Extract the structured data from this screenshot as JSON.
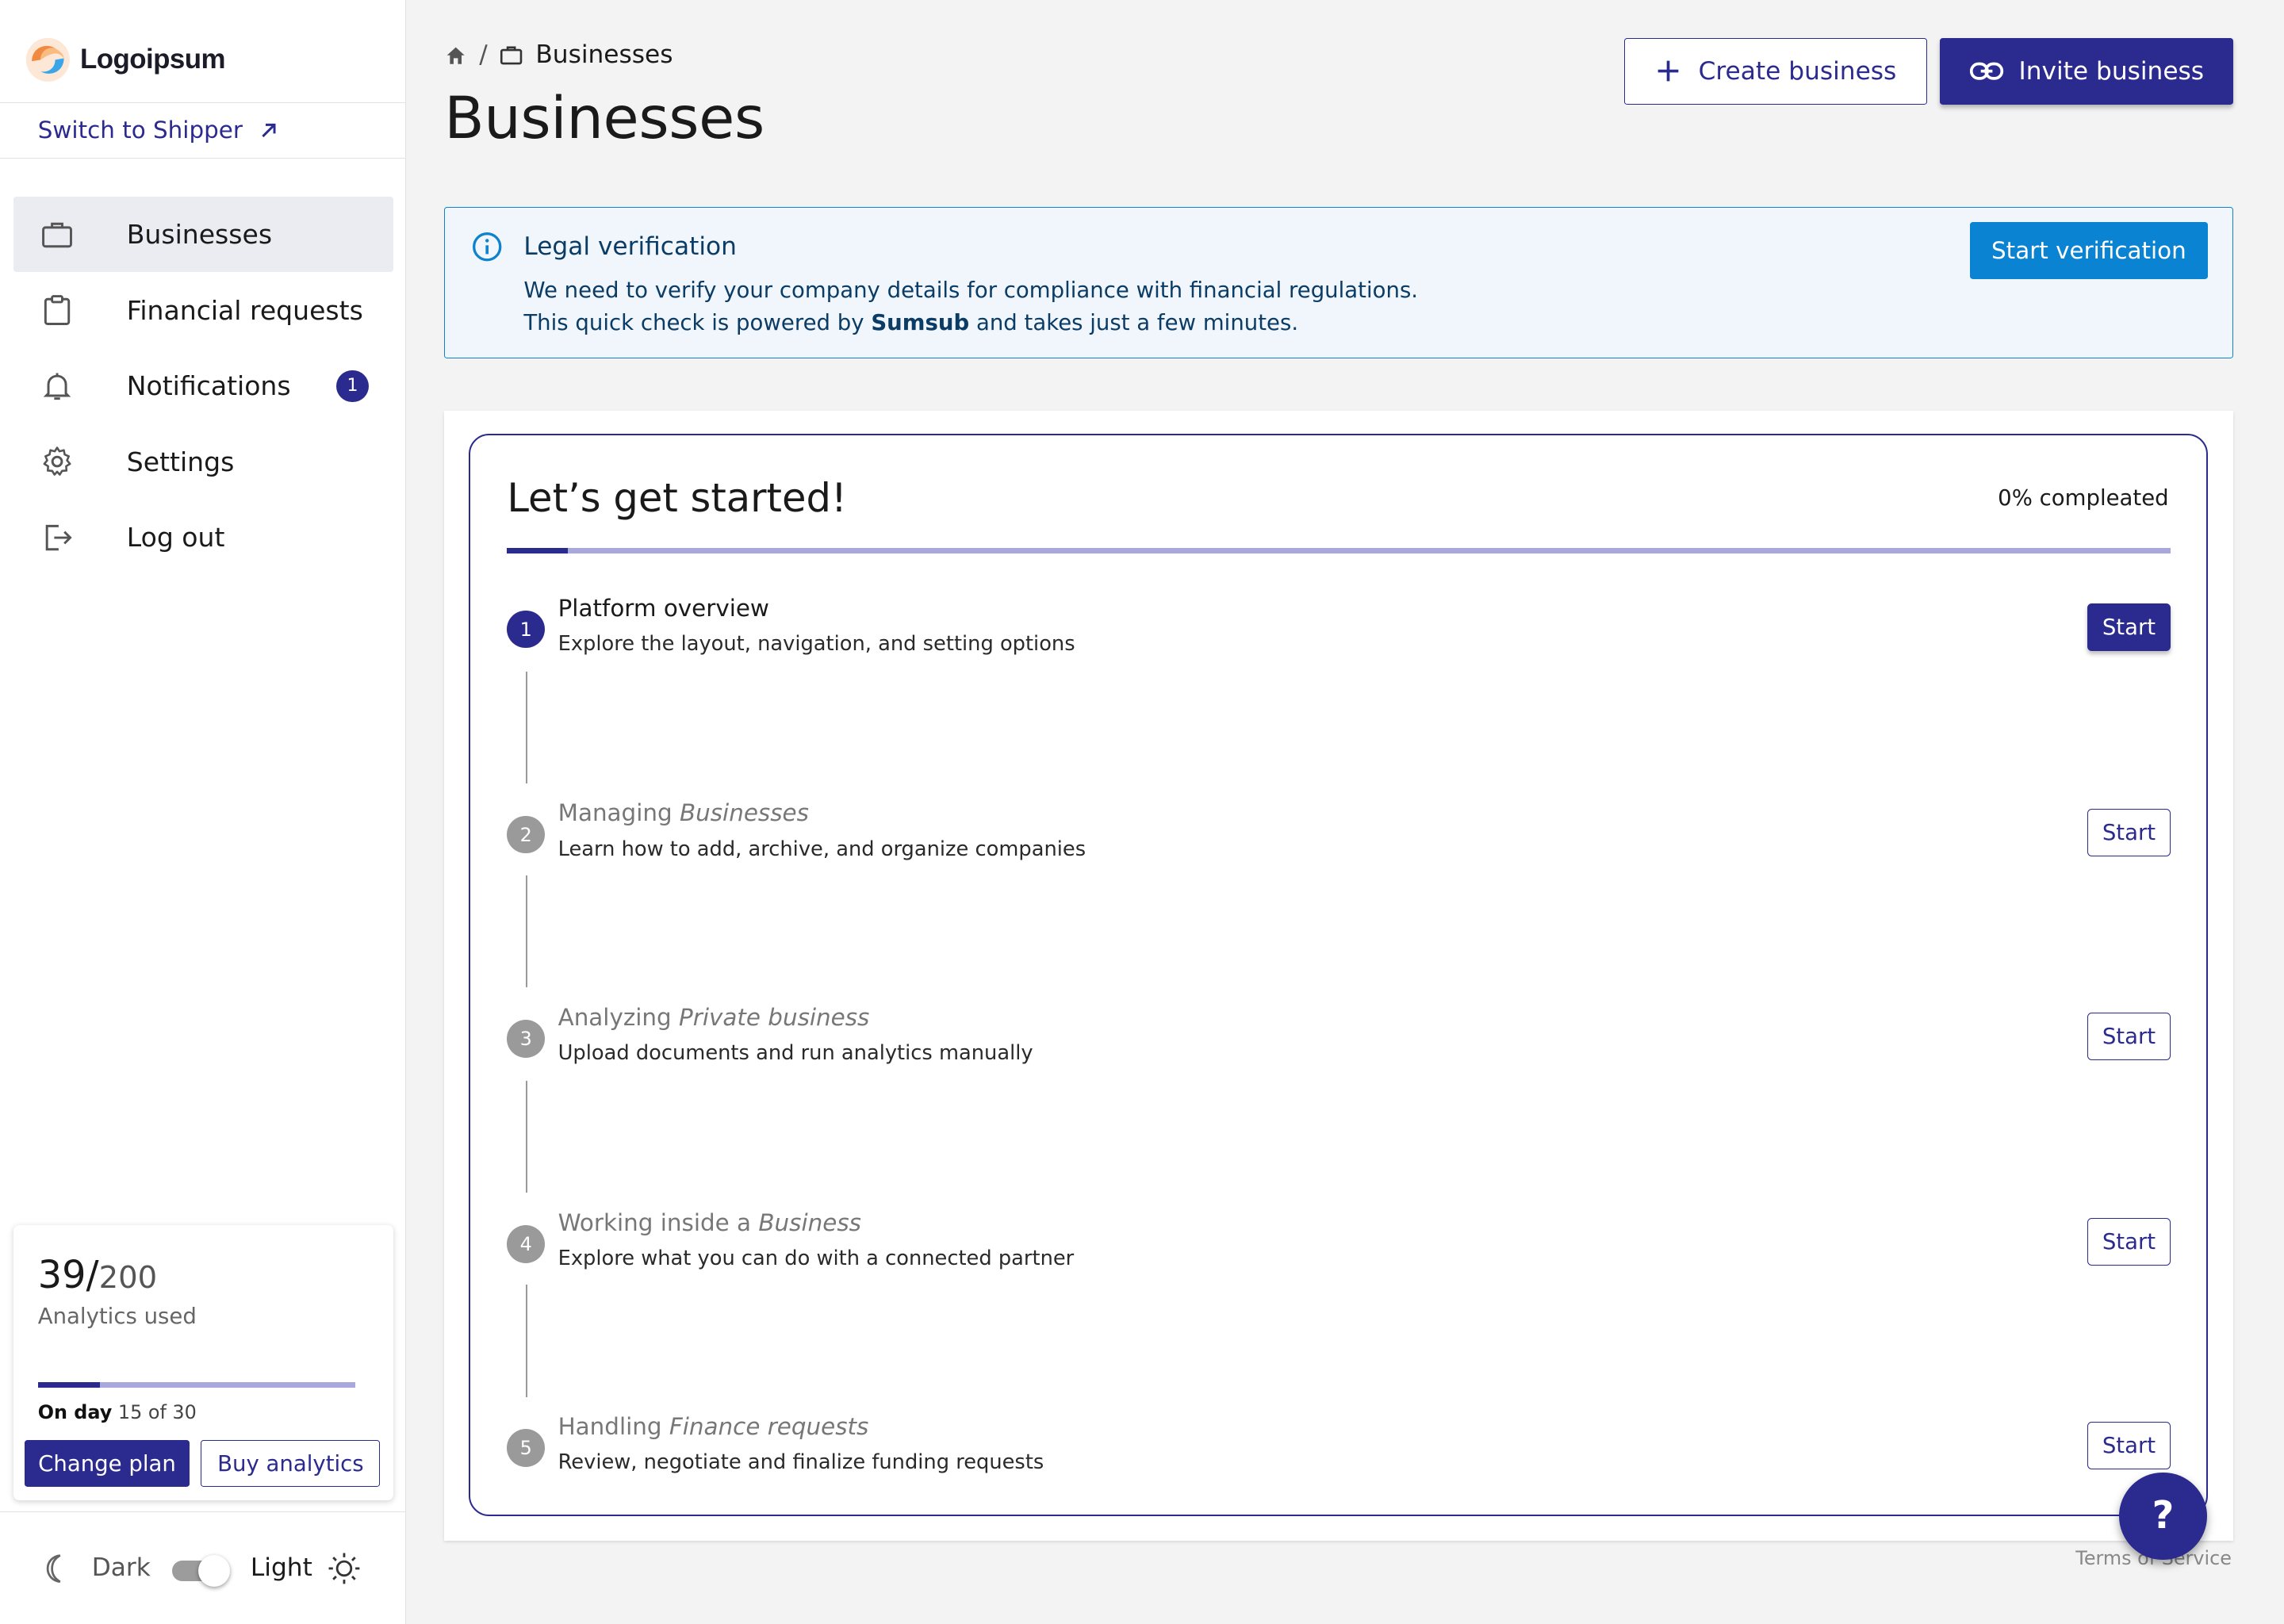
{
  "brand": {
    "name": "Logoipsum",
    "accent": "#2b2a8f"
  },
  "sidebar": {
    "switch_label": "Switch to Shipper",
    "items": [
      {
        "label": "Businesses",
        "icon": "briefcase-icon",
        "active": true
      },
      {
        "label": "Financial requests",
        "icon": "clipboard-icon"
      },
      {
        "label": "Notifications",
        "icon": "bell-icon",
        "badge": "1"
      },
      {
        "label": "Settings",
        "icon": "gear-icon"
      },
      {
        "label": "Log out",
        "icon": "logout-icon"
      }
    ],
    "usage": {
      "used": "39/",
      "total": "200",
      "label": "Analytics used",
      "progress": 0.195,
      "day_prefix": "On day",
      "day_value": "15 of 30",
      "change_plan": "Change plan",
      "buy_analytics": "Buy analytics"
    },
    "theme": {
      "dark": "Dark",
      "light": "Light"
    }
  },
  "header": {
    "breadcrumb": "Businesses",
    "title": "Businesses",
    "create_button": "Create business",
    "invite_button": "Invite business"
  },
  "alert": {
    "title": "Legal verification",
    "line1": "We need to verify your company details for compliance with financial regulations.",
    "line2_pre": "This quick check is powered by ",
    "line2_bold": "Sumsub",
    "line2_post": " and takes just a few minutes.",
    "button": "Start verification"
  },
  "getting_started": {
    "title": "Let’s get started!",
    "progress_text": "0% compleated",
    "steps": [
      {
        "num": "1",
        "title_plain": "Platform overview",
        "title_italic": "",
        "desc": "Explore the layout, navigation, and setting options",
        "button": "Start",
        "state": "active"
      },
      {
        "num": "2",
        "title_plain": "Managing ",
        "title_italic": "Businesses",
        "desc": "Learn how to add, archive, and organize companies",
        "button": "Start",
        "state": "pending"
      },
      {
        "num": "3",
        "title_plain": "Analyzing ",
        "title_italic": "Private business",
        "desc": "Upload documents and run analytics manually",
        "button": "Start",
        "state": "pending"
      },
      {
        "num": "4",
        "title_plain": "Working inside a ",
        "title_italic": "Business",
        "desc": "Explore what you can do with a connected partner",
        "button": "Start",
        "state": "pending"
      },
      {
        "num": "5",
        "title_plain": "Handling ",
        "title_italic": "Finance requests",
        "desc": "Review, negotiate and finalize funding requests",
        "button": "Start",
        "state": "pending"
      }
    ]
  },
  "help_button": "?",
  "footer": {
    "terms": "Terms of Service"
  }
}
